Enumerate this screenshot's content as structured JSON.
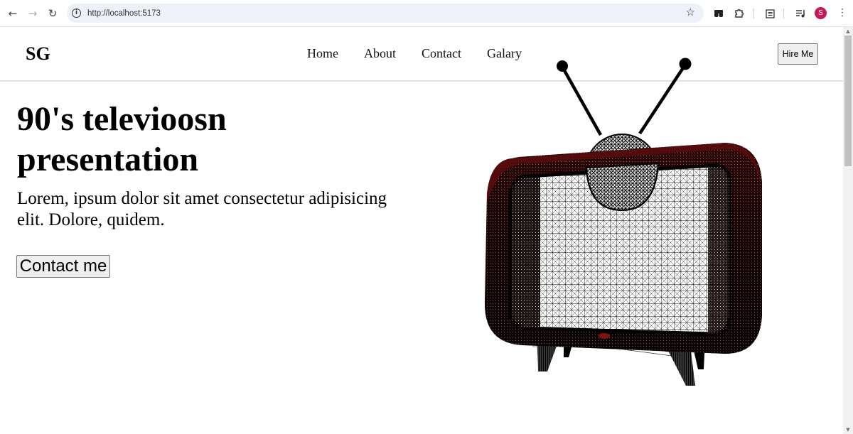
{
  "browser": {
    "url": "http://localhost:5173",
    "back_icon": "←",
    "forward_icon": "→",
    "reload_icon": "↻",
    "info_icon": "i",
    "bookmark_icon": "☆",
    "profile_initial": "S",
    "profile_color": "#c8175b",
    "menu_icon": "⋮"
  },
  "site": {
    "logo": "SG",
    "nav": [
      {
        "label": "Home"
      },
      {
        "label": "About"
      },
      {
        "label": "Contact"
      },
      {
        "label": "Galary"
      }
    ],
    "hire_button": "Hire Me"
  },
  "hero": {
    "title": "90's televioosn presentation",
    "description": "Lorem, ipsum dolor sit amet consectetur adipisicing elit. Dolore, quidem.",
    "cta": "Contact me"
  },
  "model": {
    "subject": "retro television 3D wireframe",
    "body_color": "#5a0c0c",
    "wire_color": "#000000"
  }
}
